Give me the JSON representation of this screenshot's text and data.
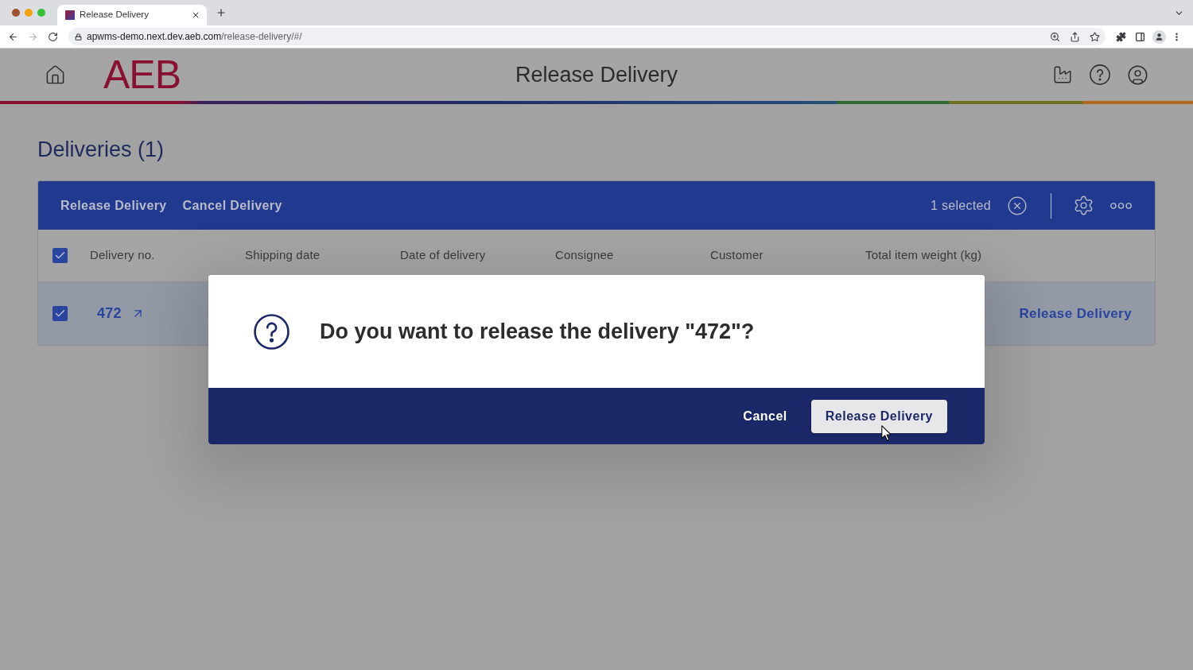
{
  "browser": {
    "tab": {
      "title": "Release Delivery",
      "selected": true
    },
    "nav": [
      {
        "kind": "back",
        "disabled": false
      },
      {
        "kind": "forward",
        "disabled": true
      },
      {
        "kind": "reload",
        "disabled": false
      }
    ],
    "url": {
      "host": "apwms-demo.next.dev.aeb.com",
      "path": "/release-delivery/#/"
    }
  },
  "header": {
    "logo": "AEB",
    "title": "Release Delivery"
  },
  "page": {
    "title": "Deliveries (1)"
  },
  "table": {
    "toolbar": {
      "actions": [
        "Release Delivery",
        "Cancel Delivery"
      ],
      "selection": "1 selected"
    },
    "select_all": {
      "checked": true
    },
    "columns": [
      "Delivery no.",
      "Shipping date",
      "Date of delivery",
      "Consignee",
      "Customer",
      "Total item weight (kg)"
    ],
    "rows": [
      {
        "selected": true,
        "checked": true,
        "delivery_no": "472",
        "action": "Release Delivery"
      }
    ]
  },
  "dialog": {
    "message": "Do you want to release the delivery \"472\"?",
    "buttons": [
      {
        "label": "Cancel",
        "kind": "secondary"
      },
      {
        "label": "Release Delivery",
        "kind": "primary"
      }
    ]
  }
}
